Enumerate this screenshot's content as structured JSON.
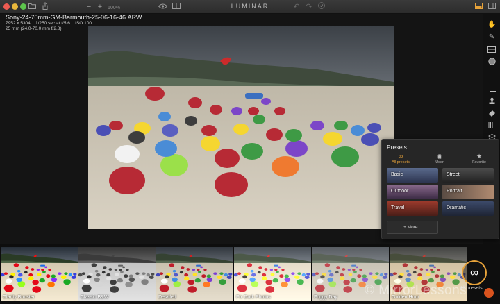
{
  "toolbar": {
    "app_title": "LUMINAR",
    "zoom_level": "100%",
    "icons": [
      "folder-icon",
      "share-icon",
      "zoom-out-icon",
      "zoom-in-icon",
      "eye-icon",
      "compare-icon",
      "undo-icon",
      "redo-icon",
      "history-icon",
      "filmstrip-toggle-icon",
      "panel-toggle-icon"
    ]
  },
  "file_info": {
    "file_name": "Sony-24-70mm-GM-Barmouth-25-06-16-46.ARW",
    "dimensions": "7952 x 5304",
    "exposure": "1/250 sec at f/5.6",
    "iso": "ISO 100",
    "lens": "25 mm (24.0-70.0 mm f/2.8)"
  },
  "tools": [
    "adjust-icon",
    "brush-icon",
    "gradient-icon",
    "radial-icon",
    "crop-icon",
    "clone-stamp-icon",
    "eraser-icon",
    "histogram-icon",
    "layers-icon"
  ],
  "presets_panel": {
    "title": "Presets",
    "tabs": [
      {
        "label": "All presets",
        "icon": "infinity-icon",
        "active": true
      },
      {
        "label": "User",
        "icon": "user-icon",
        "active": false
      },
      {
        "label": "Favorite",
        "icon": "star-icon",
        "active": false
      }
    ],
    "categories": [
      "Basic",
      "Street",
      "Outdoor",
      "Portrait",
      "Travel",
      "Dramatic"
    ],
    "more_label": "+ More..."
  },
  "filmstrip": {
    "presets": [
      "Clarity Booster",
      "Classic B&W",
      "Detailed",
      "Fix Dark Photos",
      "Foggy Day",
      "Golden Hour"
    ],
    "all_presets_label": "All presets",
    "watermark": "© MirrorLessons"
  },
  "colors": {
    "accent": "#e8a33a",
    "toolbar_bg": "#333333",
    "app_bg": "#141414"
  }
}
